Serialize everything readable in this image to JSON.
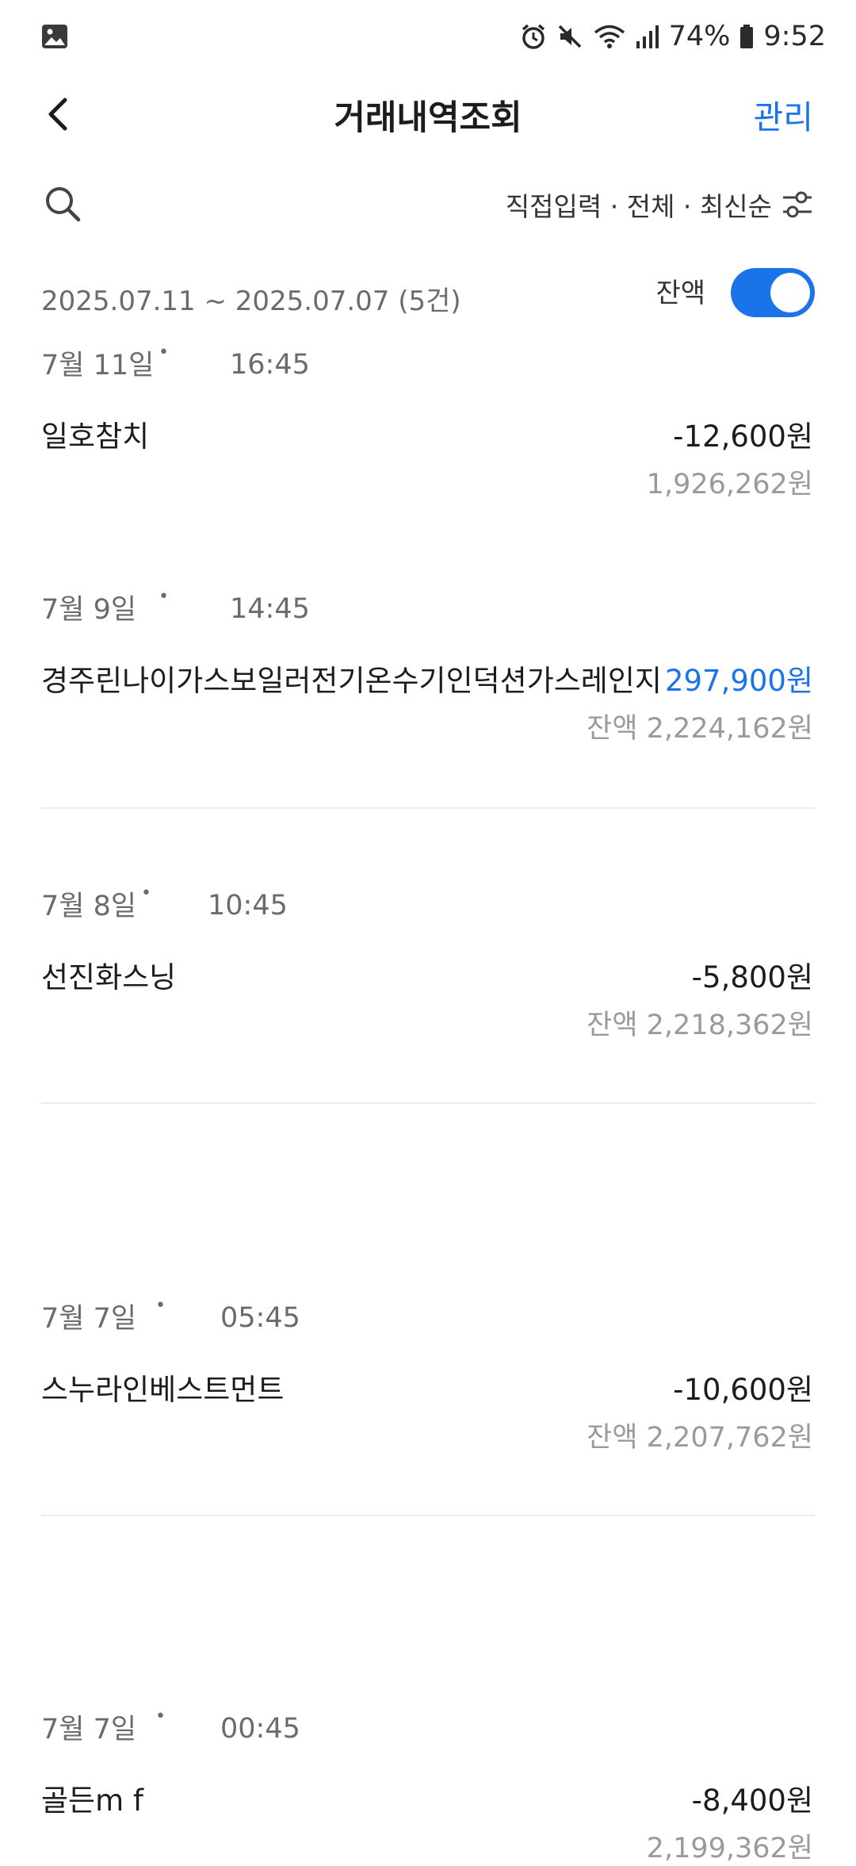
{
  "status_bar": {
    "battery": "74%",
    "time": "9:52",
    "icons": [
      "gallery-icon",
      "alarm-icon",
      "mute-icon",
      "wifi-icon",
      "signal-icon",
      "battery-icon"
    ]
  },
  "header": {
    "title": "거래내역조회",
    "manage_label": "관리"
  },
  "filter": {
    "summary": "직접입력 · 전체 · 최신순"
  },
  "range": {
    "text": "2025.07.11 ~ 2025.07.07 (5건)",
    "balance_label": "잔액",
    "balance_toggle_on": true
  },
  "transactions": [
    {
      "date": "7월 11일",
      "time": "16:45",
      "merchant": "일호참치",
      "amount": "-12,600원",
      "balance": "1,926,262원"
    },
    {
      "date": "7월 9일",
      "time": "14:45",
      "merchant": "경주린나이가스보일러전기온수기인덕션가스레인지",
      "amount": "297,900원",
      "balance": "잔액 2,224,162원"
    },
    {
      "date": "7월 8일",
      "time": "10:45",
      "merchant": "선진화스닝",
      "amount": "-5,800원",
      "balance": "잔액 2,218,362원"
    },
    {
      "date": "7월 7일",
      "time": "05:45",
      "merchant": "스누라인베스트먼트",
      "amount": "-10,600원",
      "balance": "잔액 2,207,762원"
    },
    {
      "date": "7월 7일",
      "time": "00:45",
      "merchant": "골든m f",
      "amount": "-8,400원",
      "balance": "2,199,362원"
    }
  ],
  "colors": {
    "accent": "#1a73e8",
    "text": "#1c1c1e",
    "muted": "#6b6b6b",
    "balance": "#9a9a9a"
  }
}
